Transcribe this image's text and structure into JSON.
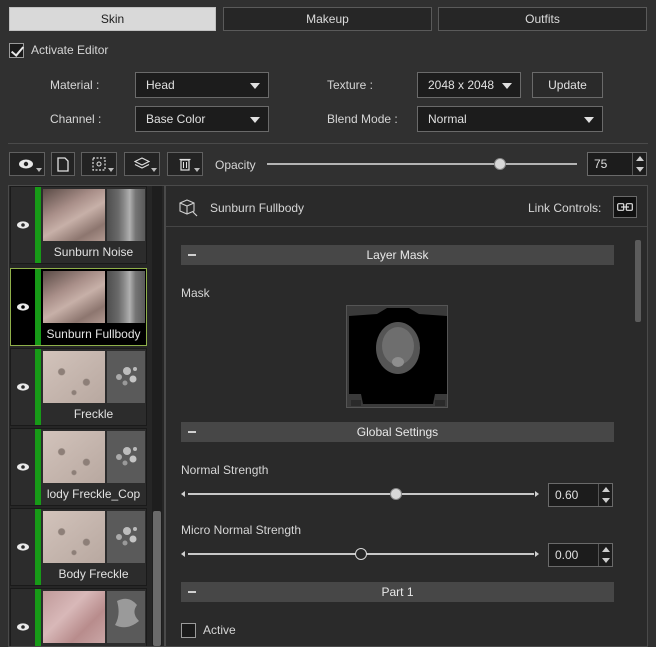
{
  "tabs": [
    {
      "label": "Skin",
      "active": true
    },
    {
      "label": "Makeup",
      "active": false
    },
    {
      "label": "Outfits",
      "active": false
    }
  ],
  "activate_editor": {
    "label": "Activate Editor",
    "checked": true
  },
  "fields": {
    "material": {
      "label": "Material :",
      "value": "Head"
    },
    "texture": {
      "label": "Texture :",
      "value": "2048 x 2048"
    },
    "update_label": "Update",
    "channel": {
      "label": "Channel :",
      "value": "Base Color"
    },
    "blend_mode": {
      "label": "Blend Mode :",
      "value": "Normal"
    }
  },
  "toolbar": {
    "opacity_label": "Opacity",
    "opacity_value": "75",
    "opacity_fraction": 0.75
  },
  "layers": [
    {
      "name": "Sunburn Noise",
      "selected": false
    },
    {
      "name": "Sunburn Fullbody",
      "selected": true
    },
    {
      "name": "Freckle",
      "selected": false
    },
    {
      "name": "lody Freckle_Cop",
      "selected": false
    },
    {
      "name": "Body Freckle",
      "selected": false
    },
    {
      "name": "",
      "selected": false
    }
  ],
  "panel": {
    "title": "Sunburn Fullbody",
    "link_controls_label": "Link Controls:",
    "sections": {
      "layer_mask": "Layer Mask",
      "global_settings": "Global Settings",
      "part1": "Part 1"
    },
    "mask_label": "Mask",
    "normal_strength": {
      "label": "Normal Strength",
      "value": "0.60",
      "fraction": 0.6
    },
    "micro_normal_strength": {
      "label": "Micro Normal Strength",
      "value": "0.00",
      "fraction": 0.5
    },
    "active": {
      "label": "Active",
      "checked": false
    }
  }
}
